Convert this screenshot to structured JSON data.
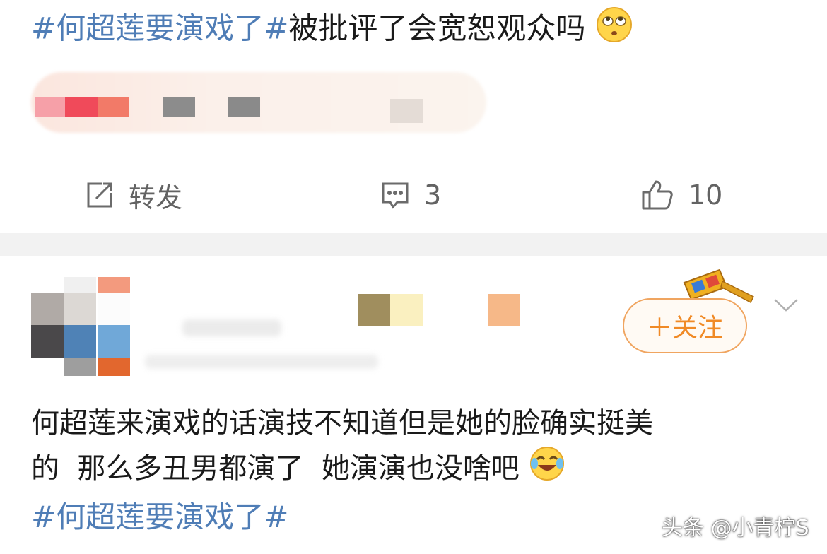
{
  "post": {
    "hashtag": "#何超莲要演戏了#",
    "text": "被批评了会宽恕观众吗",
    "emoji": "eye-roll-emoji"
  },
  "actions": {
    "repost_label": "转发",
    "comment_count": "3",
    "like_count": "10"
  },
  "comment": {
    "follow_label": "＋关注",
    "body_line1": "何超莲来演戏的话演技不知道但是她的脸确实挺美",
    "body_line2": "的  那么多丑男都演了  她演演也没啥吧",
    "emoji": "laugh-cry-emoji",
    "hashtag": "#何超莲要演戏了#"
  },
  "watermark": "头条 @小青柠S",
  "colors": {
    "hashtag": "#4f7db6",
    "follow": "#f08a26",
    "action_text": "#636363"
  }
}
